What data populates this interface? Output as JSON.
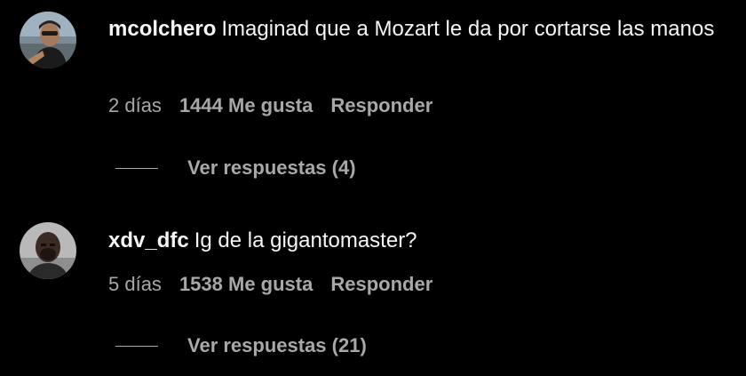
{
  "colors": {
    "background": "#000000",
    "text_primary": "#f5f5f5",
    "text_secondary": "#a8a8a8"
  },
  "comments": [
    {
      "username": "mcolchero",
      "text": "Imaginad que a Mozart le da por cortarse las manos",
      "time": "2 días",
      "likes": "1444 Me gusta",
      "reply_label": "Responder",
      "view_replies": "Ver respuestas (4)"
    },
    {
      "username": "xdv_dfc",
      "text": "Ig de la gigantomaster?",
      "time": "5 días",
      "likes": "1538 Me gusta",
      "reply_label": "Responder",
      "view_replies": "Ver respuestas (21)"
    }
  ]
}
